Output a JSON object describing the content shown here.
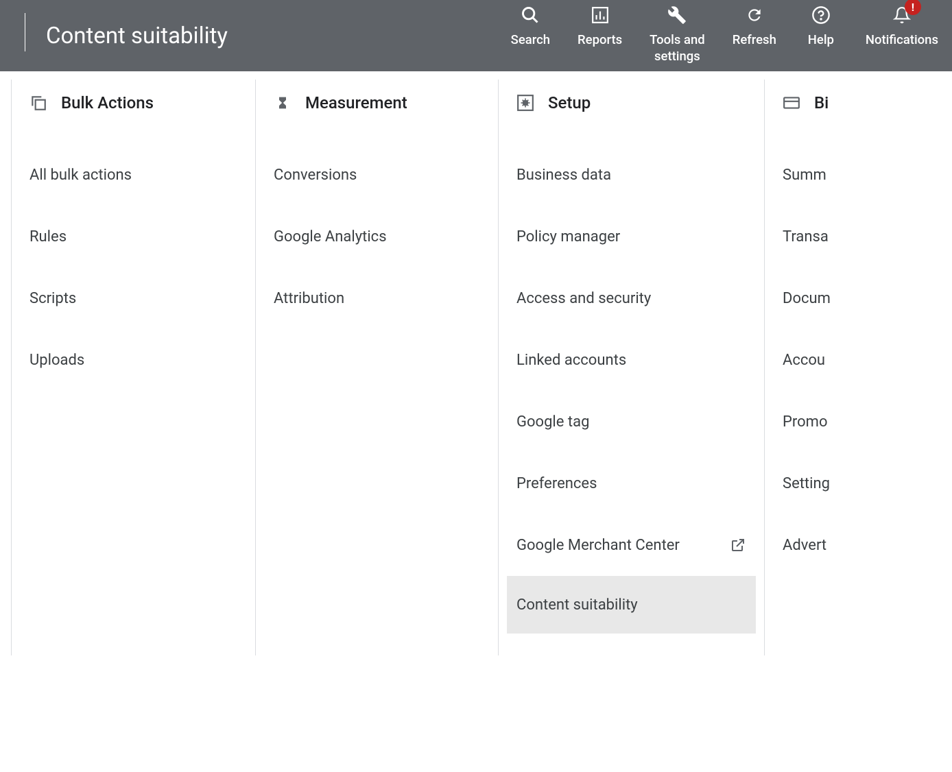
{
  "header": {
    "title": "Content suitability",
    "actions": [
      {
        "label": "Search",
        "icon": "search"
      },
      {
        "label": "Reports",
        "icon": "reports"
      },
      {
        "label": "Tools and\nsettings",
        "icon": "tools"
      },
      {
        "label": "Refresh",
        "icon": "refresh"
      },
      {
        "label": "Help",
        "icon": "help"
      },
      {
        "label": "Notifications",
        "icon": "notifications",
        "badge": "!"
      }
    ]
  },
  "columns": [
    {
      "title": "Bulk Actions",
      "icon": "bulk",
      "items": [
        {
          "label": "All bulk actions"
        },
        {
          "label": "Rules"
        },
        {
          "label": "Scripts"
        },
        {
          "label": "Uploads"
        }
      ]
    },
    {
      "title": "Measurement",
      "icon": "measurement",
      "items": [
        {
          "label": "Conversions"
        },
        {
          "label": "Google Analytics"
        },
        {
          "label": "Attribution"
        }
      ]
    },
    {
      "title": "Setup",
      "icon": "setup",
      "items": [
        {
          "label": "Business data"
        },
        {
          "label": "Policy manager"
        },
        {
          "label": "Access and security"
        },
        {
          "label": "Linked accounts"
        },
        {
          "label": "Google tag"
        },
        {
          "label": "Preferences"
        },
        {
          "label": "Google Merchant Center",
          "external": true
        },
        {
          "label": "Content suitability",
          "selected": true
        }
      ]
    },
    {
      "title": "Bi",
      "icon": "billing",
      "items": [
        {
          "label": "Summ"
        },
        {
          "label": "Transa"
        },
        {
          "label": "Docum"
        },
        {
          "label": "Accou"
        },
        {
          "label": "Promo"
        },
        {
          "label": "Setting"
        },
        {
          "label": "Advert"
        }
      ]
    }
  ]
}
